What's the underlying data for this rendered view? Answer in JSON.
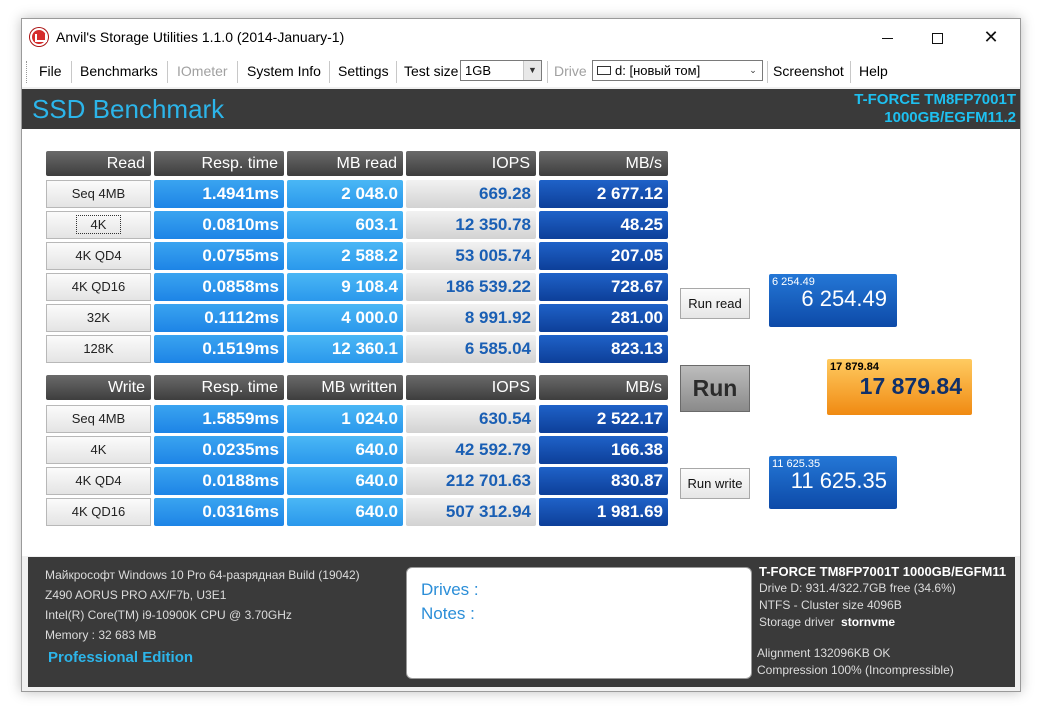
{
  "window": {
    "title": "Anvil's Storage Utilities 1.1.0 (2014-January-1)"
  },
  "menu": {
    "file": "File",
    "benchmarks": "Benchmarks",
    "iometer": "IOmeter",
    "system_info": "System Info",
    "settings": "Settings",
    "test_size_label": "Test size",
    "test_size_value": "1GB",
    "drive_label": "Drive",
    "drive_value": "d: [новый том]",
    "screenshot": "Screenshot",
    "help": "Help"
  },
  "header": {
    "title": "SSD Benchmark",
    "model_line1": "T-FORCE TM8FP7001T",
    "model_line2": "1000GB/EGFM11.2"
  },
  "read": {
    "headers": [
      "Read",
      "Resp. time",
      "MB read",
      "IOPS",
      "MB/s"
    ],
    "rows": [
      {
        "label": "Seq 4MB",
        "resp": "1.4941ms",
        "mb": "2 048.0",
        "iops": "669.28",
        "mbs": "2 677.12"
      },
      {
        "label": "4K",
        "resp": "0.0810ms",
        "mb": "603.1",
        "iops": "12 350.78",
        "mbs": "48.25"
      },
      {
        "label": "4K QD4",
        "resp": "0.0755ms",
        "mb": "2 588.2",
        "iops": "53 005.74",
        "mbs": "207.05"
      },
      {
        "label": "4K QD16",
        "resp": "0.0858ms",
        "mb": "9 108.4",
        "iops": "186 539.22",
        "mbs": "728.67"
      },
      {
        "label": "32K",
        "resp": "0.1112ms",
        "mb": "4 000.0",
        "iops": "8 991.92",
        "mbs": "281.00"
      },
      {
        "label": "128K",
        "resp": "0.1519ms",
        "mb": "12 360.1",
        "iops": "6 585.04",
        "mbs": "823.13"
      }
    ]
  },
  "write": {
    "headers": [
      "Write",
      "Resp. time",
      "MB written",
      "IOPS",
      "MB/s"
    ],
    "rows": [
      {
        "label": "Seq 4MB",
        "resp": "1.5859ms",
        "mb": "1 024.0",
        "iops": "630.54",
        "mbs": "2 522.17"
      },
      {
        "label": "4K",
        "resp": "0.0235ms",
        "mb": "640.0",
        "iops": "42 592.79",
        "mbs": "166.38"
      },
      {
        "label": "4K QD4",
        "resp": "0.0188ms",
        "mb": "640.0",
        "iops": "212 701.63",
        "mbs": "830.87"
      },
      {
        "label": "4K QD16",
        "resp": "0.0316ms",
        "mb": "640.0",
        "iops": "507 312.94",
        "mbs": "1 981.69"
      }
    ]
  },
  "buttons": {
    "run_read": "Run read",
    "run": "Run",
    "run_write": "Run write"
  },
  "scores": {
    "read_small": "6 254.49",
    "read_big": "6 254.49",
    "total_small": "17 879.84",
    "total_big": "17 879.84",
    "write_small": "11 625.35",
    "write_big": "11 625.35"
  },
  "footer": {
    "os": "Майкрософт Windows 10 Pro 64-разрядная Build (19042)",
    "board": "Z490 AORUS PRO AX/F7b, U3E1",
    "cpu": "Intel(R) Core(TM) i9-10900K CPU @ 3.70GHz",
    "memory": "Memory : 32 683 MB",
    "edition": "Professional Edition",
    "drives_label": "Drives :",
    "notes_label": "Notes :",
    "drive_title": "T-FORCE TM8FP7001T 1000GB/EGFM11",
    "drive_free": "Drive D: 931.4/322.7GB free (34.6%)",
    "ntfs": "NTFS - Cluster size 4096B",
    "storage_driver_label": "Storage driver",
    "storage_driver_value": "stornvme",
    "alignment": "Alignment 132096KB OK",
    "compression": "Compression 100% (Incompressible)"
  }
}
